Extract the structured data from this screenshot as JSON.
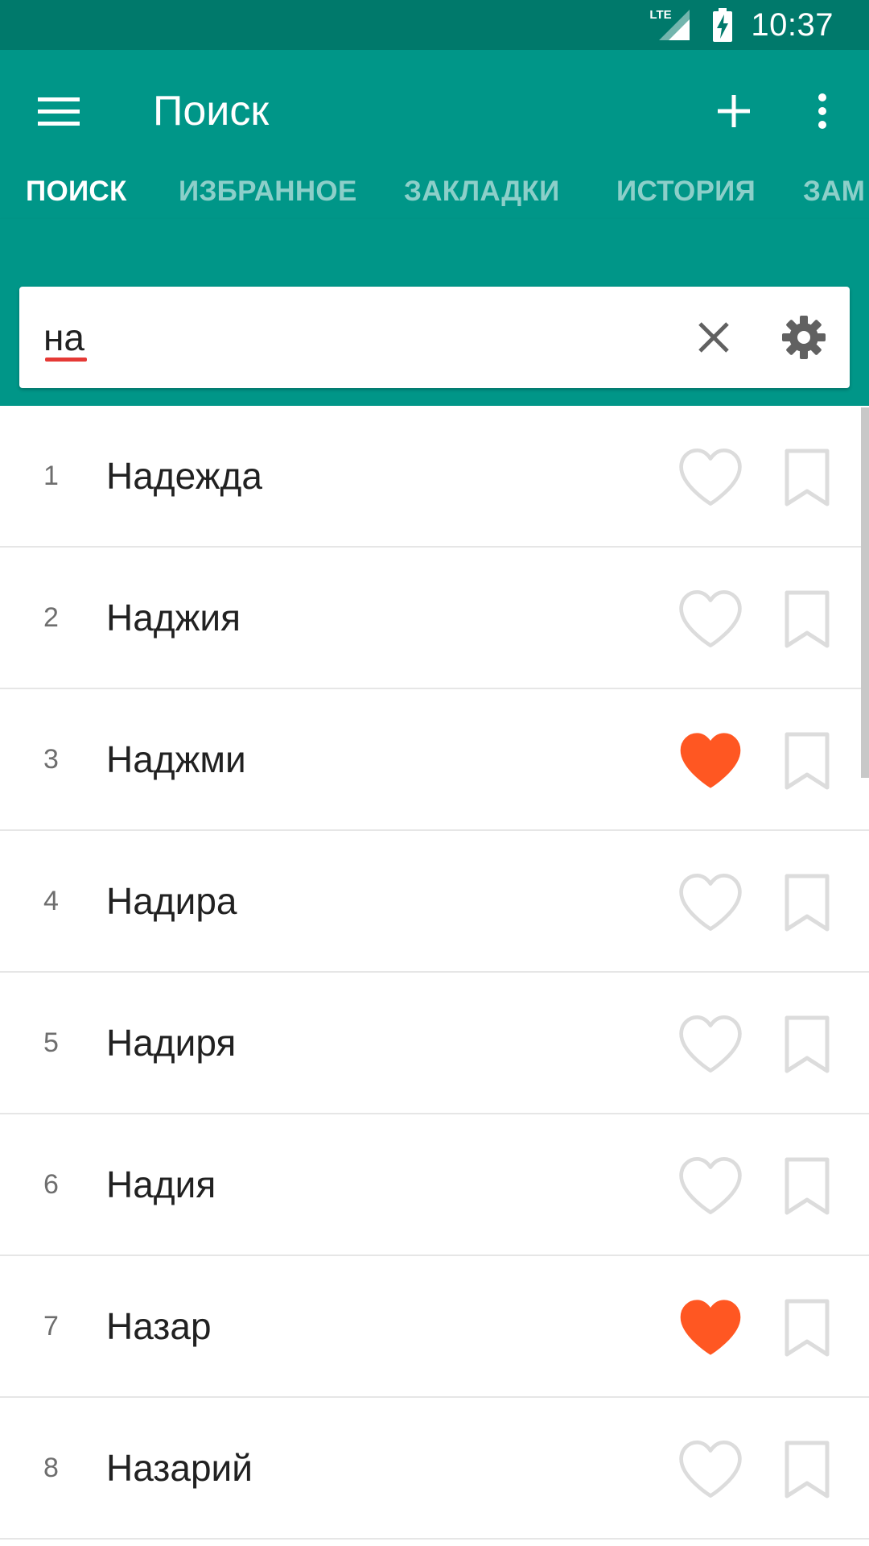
{
  "status_bar": {
    "network": "LTE",
    "time": "10:37"
  },
  "app_bar": {
    "title": "Поиск",
    "menu_icon": "menu-icon",
    "add_icon": "add-icon",
    "more_icon": "more-vert-icon"
  },
  "tabs": [
    {
      "label": "ПОИСК",
      "active": true
    },
    {
      "label": "ИЗБРАННОЕ",
      "active": false
    },
    {
      "label": "ЗАКЛАДКИ",
      "active": false
    },
    {
      "label": "ИСТОРИЯ",
      "active": false
    },
    {
      "label": "ЗАМ",
      "active": false
    }
  ],
  "search": {
    "value": "на",
    "clear_icon": "close-icon",
    "settings_icon": "gear-icon"
  },
  "colors": {
    "status_bar": "#00796b",
    "primary": "#009688",
    "favorite": "#ff5722",
    "icon_inactive": "#dcdcdc"
  },
  "results": [
    {
      "number": "1",
      "name": "Надежда",
      "favorite": false,
      "bookmarked": false
    },
    {
      "number": "2",
      "name": "Наджия",
      "favorite": false,
      "bookmarked": false
    },
    {
      "number": "3",
      "name": "Наджми",
      "favorite": true,
      "bookmarked": false
    },
    {
      "number": "4",
      "name": "Надира",
      "favorite": false,
      "bookmarked": false
    },
    {
      "number": "5",
      "name": "Надиря",
      "favorite": false,
      "bookmarked": false
    },
    {
      "number": "6",
      "name": "Надия",
      "favorite": false,
      "bookmarked": false
    },
    {
      "number": "7",
      "name": "Назар",
      "favorite": true,
      "bookmarked": false
    },
    {
      "number": "8",
      "name": "Назарий",
      "favorite": false,
      "bookmarked": false
    }
  ]
}
